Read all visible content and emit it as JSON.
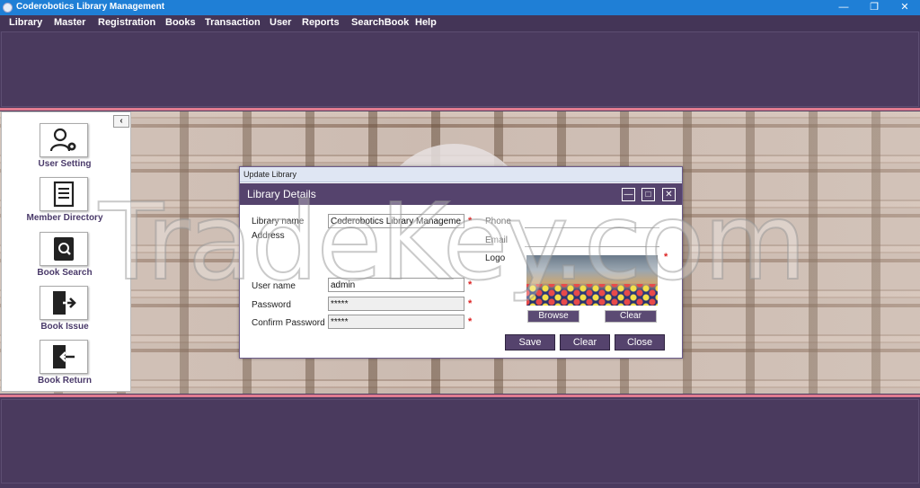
{
  "window": {
    "title": "Coderobotics Library Management",
    "min_glyph": "—",
    "restore_glyph": "❐",
    "close_glyph": "✕"
  },
  "menu": [
    "Library",
    "Master",
    "Registration",
    "Books",
    "Transaction",
    "User",
    "Reports",
    "SearchBook",
    "Help"
  ],
  "sidebar": {
    "collapse_glyph": "‹",
    "items": [
      {
        "label": "User Setting",
        "icon": "user-gear-icon"
      },
      {
        "label": "Member Directory",
        "icon": "document-list-icon"
      },
      {
        "label": "Book Search",
        "icon": "book-search-icon"
      },
      {
        "label": "Book Issue",
        "icon": "door-exit-icon"
      },
      {
        "label": "Book Return",
        "icon": "door-enter-icon"
      }
    ]
  },
  "dialog": {
    "window_title": "Update Library",
    "header": "Library Details",
    "min_glyph": "—",
    "max_glyph": "□",
    "close_glyph": "✕",
    "labels": {
      "library_name": "Library name",
      "address": "Address",
      "phone": "Phone",
      "email": "Email",
      "logo": "Logo",
      "username": "User name",
      "password": "Password",
      "confirm_password": "Confirm Password"
    },
    "values": {
      "library_name": "Coderobotics Library Manageme",
      "phone": "",
      "email": "",
      "username": "admin",
      "password": "*****",
      "confirm_password": "*****"
    },
    "required_mark": "*",
    "buttons": {
      "browse": "Browse",
      "clear_logo": "Clear",
      "save": "Save",
      "clear": "Clear",
      "close": "Close"
    }
  },
  "watermark": "TradeKey.com",
  "colors": {
    "titlebar": "#1f7fd6",
    "menubar": "#443557",
    "accent": "#55436d",
    "pink_line": "#e07b90",
    "required": "#dd2222"
  }
}
